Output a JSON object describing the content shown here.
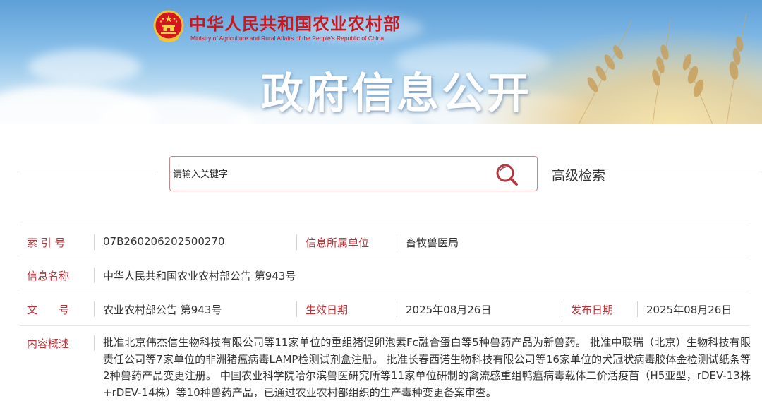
{
  "header": {
    "ministry_name_cn": "中华人民共和国农业农村部",
    "ministry_name_en": "Ministry of Agriculture and Rural Affairs of the People's Republic of China",
    "banner_title": "政府信息公开",
    "emblem_icon": "national-emblem-icon"
  },
  "search": {
    "placeholder": "请输入关键字",
    "button_icon": "search-icon",
    "advanced_label": "高级检索"
  },
  "info": {
    "index_label": "索 引 号",
    "index_value": "07B260206202500270",
    "unit_label": "信息所属单位",
    "unit_value": "畜牧兽医局",
    "name_label": "信息名称",
    "name_value": "中华人民共和国农业农村部公告 第943号",
    "doc_label": "文　　号",
    "doc_value": "农业农村部公告 第943号",
    "effective_label": "生效日期",
    "effective_value": "2025年08月26日",
    "publish_label": "发布日期",
    "publish_value": "2025年08月26日",
    "summary_label": "内容概述",
    "summary_value": "批准北京伟杰信生物科技有限公司等11家单位的重组猪促卵泡素Fc融合蛋白等5种兽药产品为新兽药。 批准中联瑞（北京）生物科技有限责任公司等7家单位的非洲猪瘟病毒LAMP检测试剂盒注册。 批准长春西诺生物科技有限公司等16家单位的犬冠状病毒胶体金检测试纸条等2种兽药产品变更注册。 中国农业科学院哈尔滨兽医研究所等11家单位研制的禽流感重组鸭瘟病毒载体二价活疫苗（H5亚型，rDEV-13株+rDEV-14株）等10种兽药产品，已通过农业农村部组织的生产毒种变更备案审查。"
  },
  "colors": {
    "brand_red": "#c8171e",
    "label_red": "#b9333a",
    "search_border": "#c9878a"
  }
}
